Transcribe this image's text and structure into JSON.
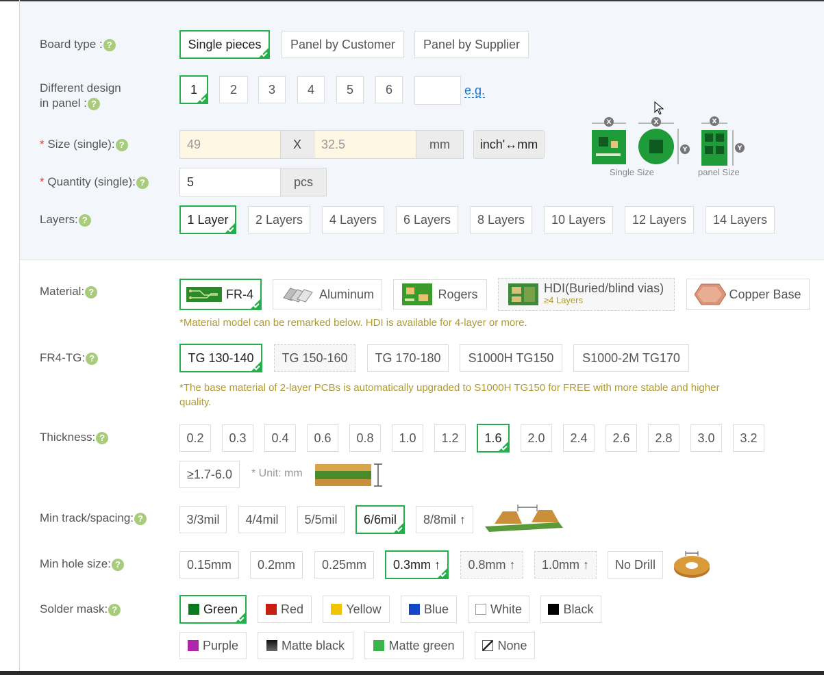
{
  "colors": {
    "accent": "#23b04a",
    "note": "#b09a32",
    "link": "#1a73c9",
    "required": "#e53935"
  },
  "help_icon": "?",
  "board_type": {
    "label": "Board type :",
    "options": [
      "Single pieces",
      "Panel by Customer",
      "Panel by Supplier"
    ],
    "selected": "Single pieces"
  },
  "different_design": {
    "label_line1": "Different design",
    "label_line2": "in panel :",
    "options": [
      "1",
      "2",
      "3",
      "4",
      "5",
      "6"
    ],
    "selected": "1",
    "custom_value": "",
    "eg_link": "e.g."
  },
  "size": {
    "required_mark": "*",
    "label": "Size (single):",
    "width_value": "49",
    "separator": "X",
    "height_value": "32.5",
    "unit": "mm",
    "convert_button": "inch'↔mm"
  },
  "quantity": {
    "required_mark": "*",
    "label": "Quantity (single):",
    "value": "5",
    "unit": "pcs"
  },
  "size_diagram": {
    "single_caption": "Single Size",
    "panel_caption": "panel Size",
    "x_mark": "X",
    "y_mark": "Y"
  },
  "layers": {
    "label": "Layers:",
    "options": [
      "1 Layer",
      "2 Layers",
      "4 Layers",
      "6 Layers",
      "8 Layers",
      "10 Layers",
      "12 Layers",
      "14 Layers"
    ],
    "selected": "1 Layer"
  },
  "material": {
    "label": "Material:",
    "options": [
      "FR-4",
      "Aluminum",
      "Rogers",
      "HDI(Buried/blind vias)",
      "Copper Base"
    ],
    "hdi_sub": "≥4 Layers",
    "selected": "FR-4",
    "note": "*Material model can be remarked below. HDI is available for 4-layer or more."
  },
  "fr4_tg": {
    "label": "FR4-TG:",
    "options": [
      "TG 130-140",
      "TG 150-160",
      "TG 170-180",
      "S1000H TG150",
      "S1000-2M TG170"
    ],
    "selected": "TG 130-140",
    "note_line1": "*The base material of 2-layer PCBs is automatically upgraded to S1000H TG150 for FREE with more stable and higher",
    "note_line2": "quality."
  },
  "thickness": {
    "label": "Thickness:",
    "options": [
      "0.2",
      "0.3",
      "0.4",
      "0.6",
      "0.8",
      "1.0",
      "1.2",
      "1.6",
      "2.0",
      "2.4",
      "2.6",
      "2.8",
      "3.0",
      "3.2"
    ],
    "extra_option": "≥1.7-6.0",
    "selected": "1.6",
    "unit_note": "* Unit: mm"
  },
  "min_track": {
    "label": "Min track/spacing:",
    "options": [
      "3/3mil",
      "4/4mil",
      "5/5mil",
      "6/6mil",
      "8/8mil ↑"
    ],
    "selected": "6/6mil"
  },
  "min_hole": {
    "label": "Min hole size:",
    "options": [
      "0.15mm",
      "0.2mm",
      "0.25mm",
      "0.3mm ↑",
      "0.8mm ↑",
      "1.0mm ↑",
      "No Drill"
    ],
    "selected": "0.3mm ↑"
  },
  "solder_mask": {
    "label": "Solder mask:",
    "options": [
      {
        "name": "Green",
        "color": "#0a7a1e"
      },
      {
        "name": "Red",
        "color": "#c81e14"
      },
      {
        "name": "Yellow",
        "color": "#f2c400"
      },
      {
        "name": "Blue",
        "color": "#1446c8"
      },
      {
        "name": "White",
        "color": "#ffffff"
      },
      {
        "name": "Black",
        "color": "#000000"
      },
      {
        "name": "Purple",
        "color": "#b024b0"
      },
      {
        "name": "Matte black",
        "color": "#333333"
      },
      {
        "name": "Matte green",
        "color": "#3cb44a"
      },
      {
        "name": "None",
        "color": "none"
      }
    ],
    "selected": "Green"
  }
}
